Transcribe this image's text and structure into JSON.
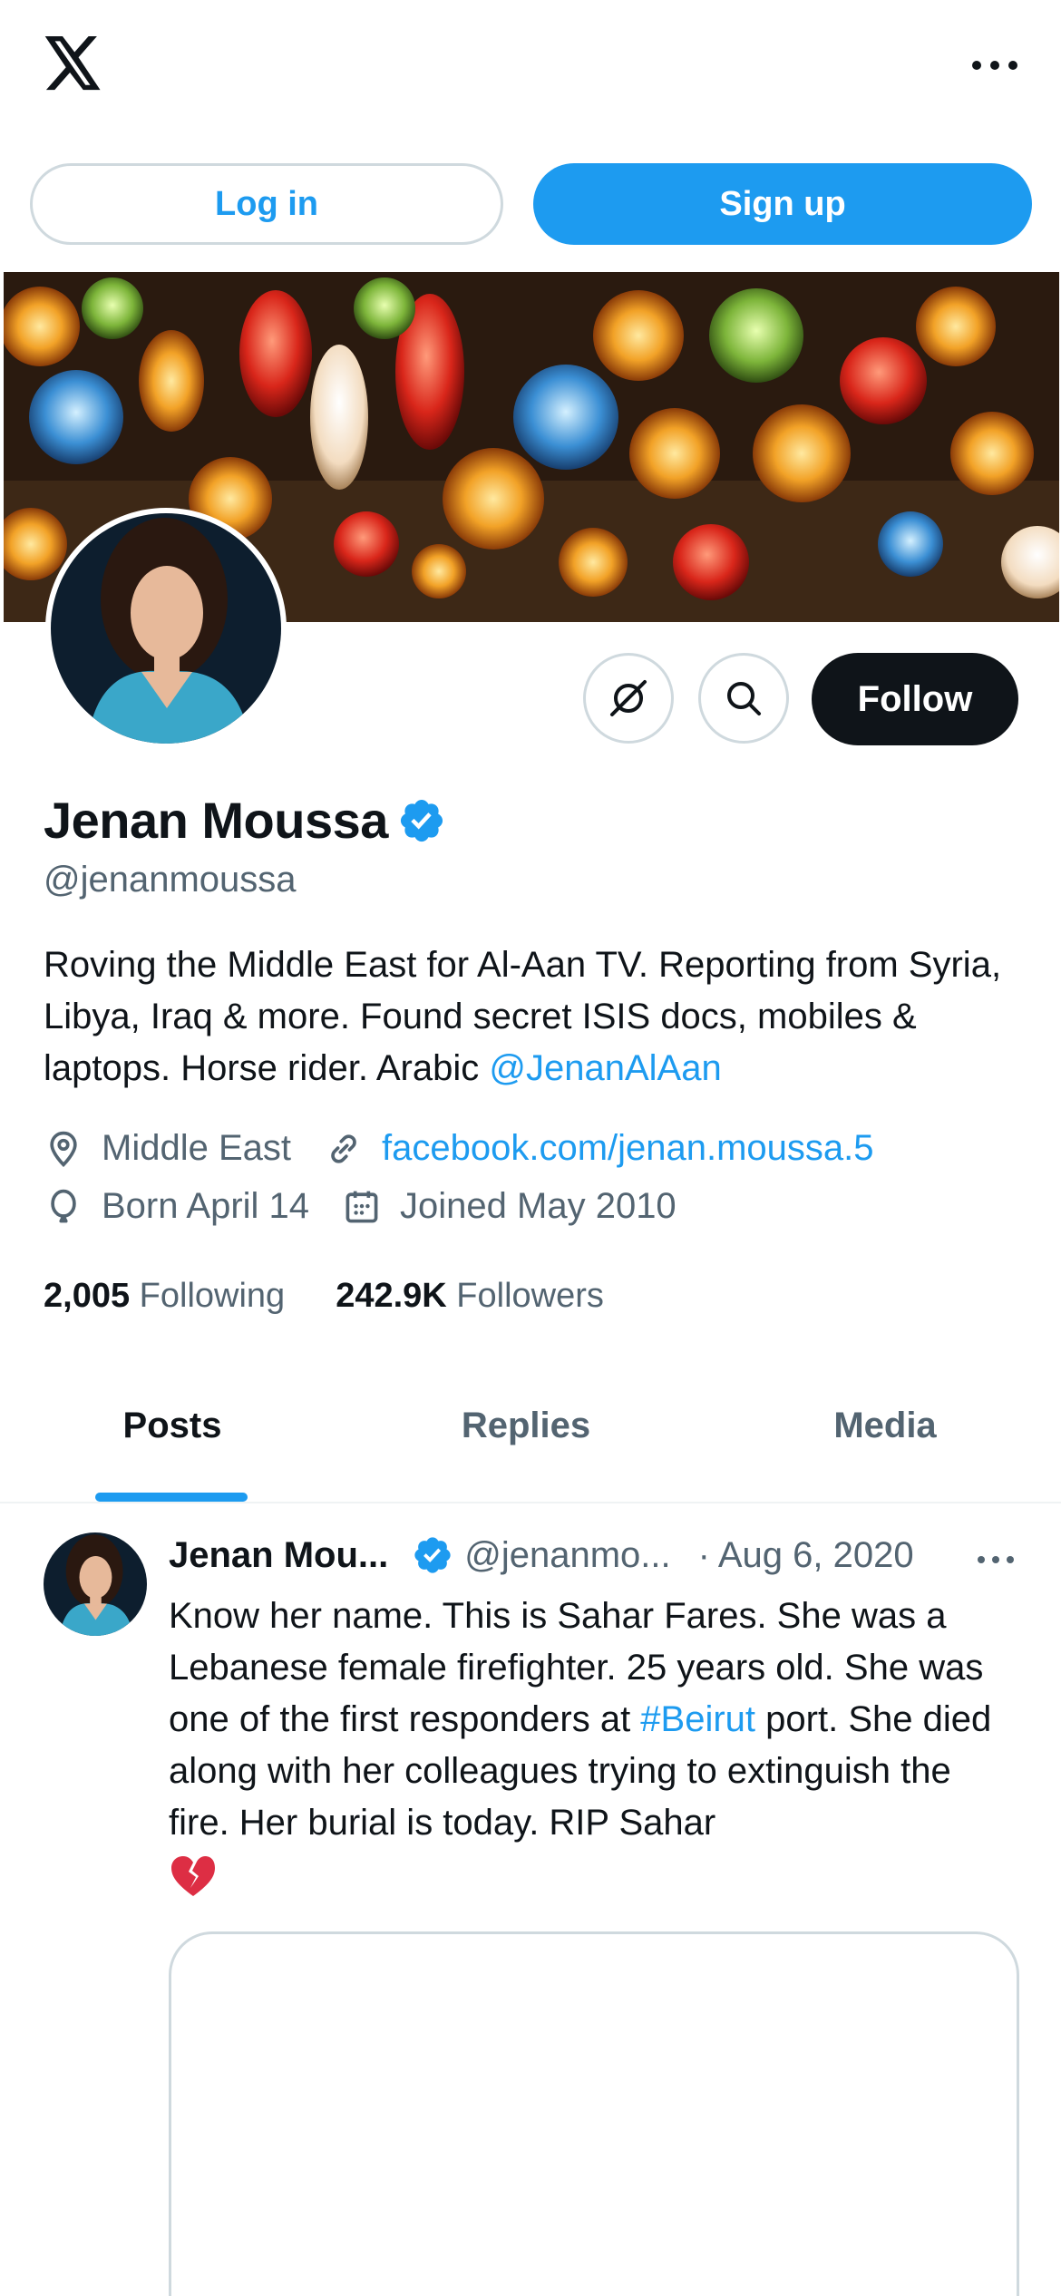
{
  "header": {
    "logo_icon": "x-logo-icon",
    "more_icon": "more-horizontal-icon"
  },
  "auth": {
    "login_label": "Log in",
    "signup_label": "Sign up"
  },
  "profile": {
    "display_name": "Jenan Moussa",
    "handle": "@jenanmoussa",
    "verified": true,
    "bio_text": "Roving the Middle East for Al-Aan TV. Reporting from Syria, Libya, Iraq & more. Found secret ISIS docs, mobiles & laptops. Horse rider. Arabic ",
    "bio_mention": "@JenanAlAan",
    "location": "Middle East",
    "website": "facebook.com/jenan.moussa.5",
    "birthday": "Born April 14",
    "joined": "Joined May 2010",
    "following_count": "2,005",
    "following_label": "Following",
    "followers_count": "242.9K",
    "followers_label": "Followers",
    "follow_label": "Follow"
  },
  "tabs": [
    {
      "label": "Posts",
      "active": true
    },
    {
      "label": "Replies",
      "active": false
    },
    {
      "label": "Media",
      "active": false
    }
  ],
  "post": {
    "author_name": "Jenan Mou...",
    "author_handle": "@jenanmo...",
    "separator": "·",
    "date": "Aug 6, 2020",
    "text_before": "Know her name. This is Sahar Fares. She was a Lebanese female firefighter. 25 years old. She was one of the first responders at ",
    "hashtag": "#Beirut",
    "text_after": " port. She died along with her colleagues trying to extinguish the fire. Her burial is today. RIP Sahar",
    "emoji": "broken-heart"
  },
  "colors": {
    "accent": "#1d9bf0",
    "text_primary": "#0f1419",
    "text_secondary": "#536471",
    "border": "#cfd9de"
  }
}
